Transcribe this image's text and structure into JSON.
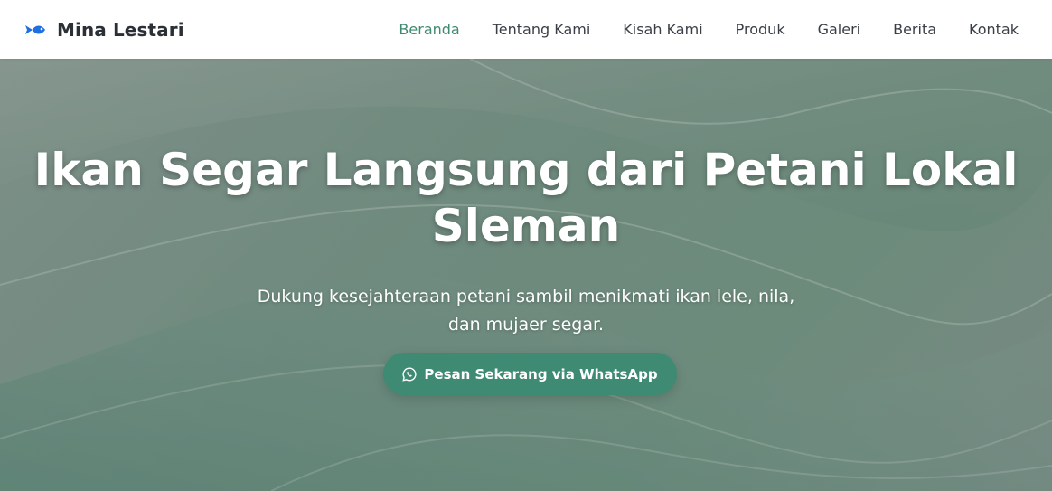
{
  "brand": {
    "name": "Mina Lestari",
    "icon": "fish-icon",
    "icon_color": "#1e6fe0"
  },
  "nav": {
    "items": [
      {
        "label": "Beranda",
        "active": true
      },
      {
        "label": "Tentang Kami",
        "active": false
      },
      {
        "label": "Kisah Kami",
        "active": false
      },
      {
        "label": "Produk",
        "active": false
      },
      {
        "label": "Galeri",
        "active": false
      },
      {
        "label": "Berita",
        "active": false
      },
      {
        "label": "Kontak",
        "active": false
      }
    ],
    "active_color": "#3e8a72"
  },
  "hero": {
    "title_line1": "Ikan Segar Langsung dari Petani Lokal",
    "title_line2": "Sleman",
    "subtitle_line1": "Dukung kesejahteraan petani sambil menikmati ikan lele, nila,",
    "subtitle_line2": "dan mujaer segar.",
    "cta_label": "Pesan Sekarang via WhatsApp",
    "cta_icon": "whatsapp-icon",
    "cta_color": "#3e8a72"
  }
}
